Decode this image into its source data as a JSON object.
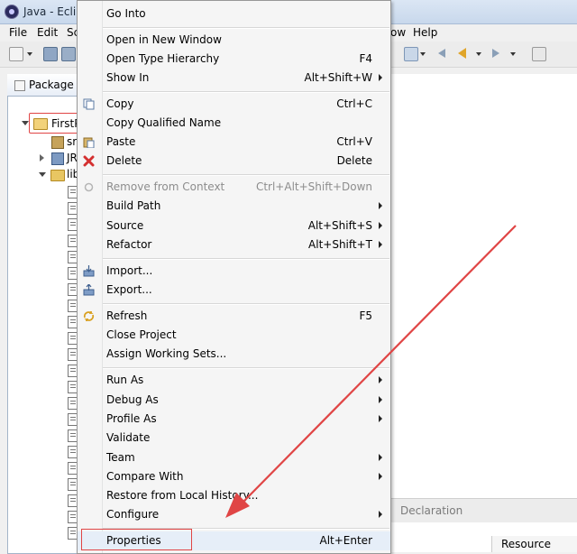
{
  "window": {
    "title": "Java - Eclipse"
  },
  "menubar": {
    "file": "File",
    "edit": "Edit",
    "source_partial": "Sc",
    "window_partial": "ow",
    "help": "Help"
  },
  "explorer": {
    "tab_label": "Package E",
    "project_label": "FirstP",
    "row_src": "sr",
    "row_jre": "JR",
    "row_lib": "lib"
  },
  "context_menu": {
    "items": [
      {
        "label": "Go Into",
        "accel": ""
      },
      {
        "label": "Open in New Window",
        "accel": ""
      },
      {
        "label": "Open Type Hierarchy",
        "accel": "F4"
      },
      {
        "label": "Show In",
        "accel": "Alt+Shift+W"
      },
      {
        "label": "Copy",
        "accel": "Ctrl+C"
      },
      {
        "label": "Copy Qualified Name",
        "accel": ""
      },
      {
        "label": "Paste",
        "accel": "Ctrl+V"
      },
      {
        "label": "Delete",
        "accel": "Delete"
      },
      {
        "label": "Remove from Context",
        "accel": "Ctrl+Alt+Shift+Down"
      },
      {
        "label": "Build Path",
        "accel": ""
      },
      {
        "label": "Source",
        "accel": "Alt+Shift+S"
      },
      {
        "label": "Refactor",
        "accel": "Alt+Shift+T"
      },
      {
        "label": "Import...",
        "accel": ""
      },
      {
        "label": "Export...",
        "accel": ""
      },
      {
        "label": "Refresh",
        "accel": "F5"
      },
      {
        "label": "Close Project",
        "accel": ""
      },
      {
        "label": "Assign Working Sets...",
        "accel": ""
      },
      {
        "label": "Run As",
        "accel": ""
      },
      {
        "label": "Debug As",
        "accel": ""
      },
      {
        "label": "Profile As",
        "accel": ""
      },
      {
        "label": "Validate",
        "accel": ""
      },
      {
        "label": "Team",
        "accel": ""
      },
      {
        "label": "Compare With",
        "accel": ""
      },
      {
        "label": "Restore from Local History...",
        "accel": ""
      },
      {
        "label": "Configure",
        "accel": ""
      },
      {
        "label": "Properties",
        "accel": "Alt+Enter"
      }
    ]
  },
  "bottom_panel": {
    "declaration_tab": "Declaration",
    "resource_header": "Resource"
  },
  "colors": {
    "highlight": "#e04545",
    "menu_bg": "#f5f5f5"
  },
  "icons": {
    "copy": "copy-icon",
    "paste": "paste-icon",
    "delete": "delete-icon",
    "remove": "remove-context-icon",
    "import": "import-icon",
    "export": "export-icon",
    "refresh": "refresh-icon"
  }
}
